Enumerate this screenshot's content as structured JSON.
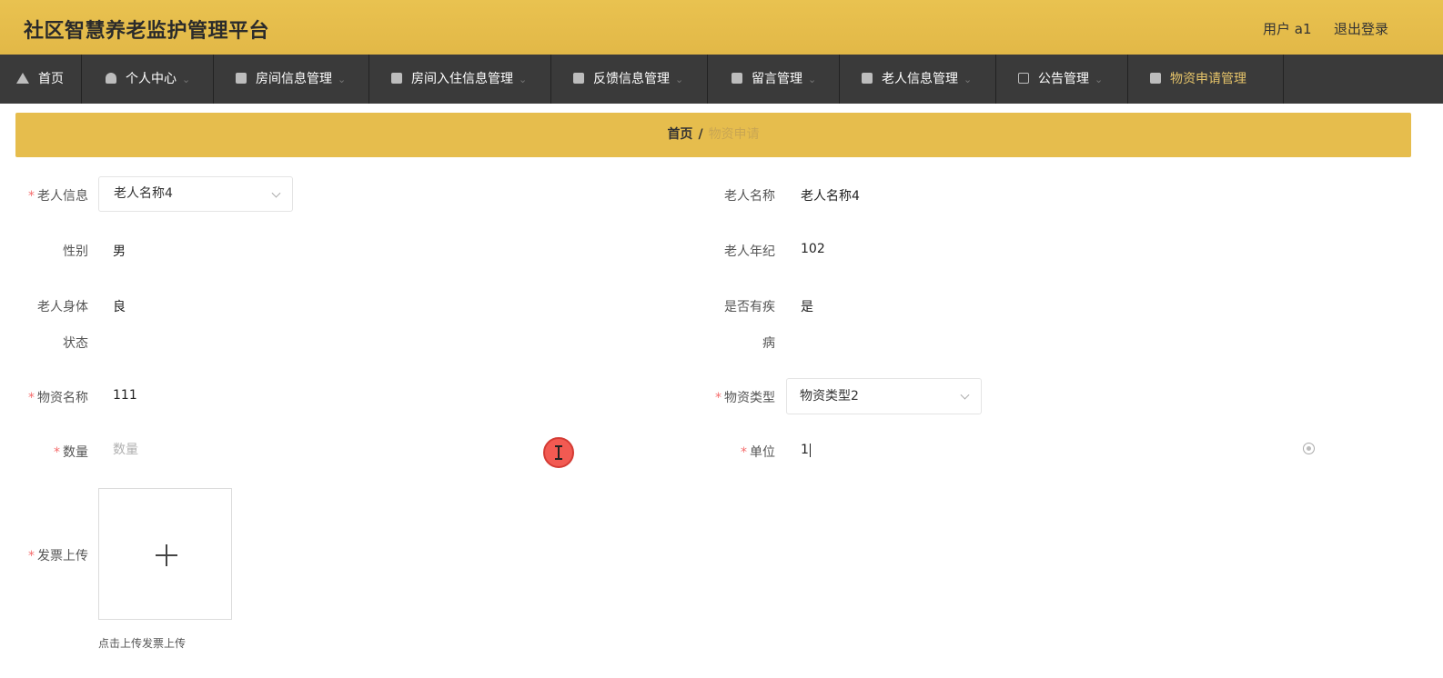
{
  "header": {
    "app_title": "社区智慧养老监护管理平台",
    "user_label": "用户 a1",
    "logout_label": "退出登录"
  },
  "nav": {
    "items": [
      {
        "label": "首页",
        "icon": "home-icon"
      },
      {
        "label": "个人中心",
        "icon": "user-icon"
      },
      {
        "label": "房间信息管理",
        "icon": "briefcase-icon"
      },
      {
        "label": "房间入住信息管理",
        "icon": "monitor-icon"
      },
      {
        "label": "反馈信息管理",
        "icon": "clipboard-icon"
      },
      {
        "label": "留言管理",
        "icon": "document-icon"
      },
      {
        "label": "老人信息管理",
        "icon": "monitor-icon"
      },
      {
        "label": "公告管理",
        "icon": "mail-icon"
      },
      {
        "label": "物资申请管理",
        "icon": "clipboard-icon"
      }
    ],
    "active_index": 8,
    "chevron": "⌄"
  },
  "breadcrumb": {
    "home": "首页",
    "separator": "/",
    "current": "物资申请"
  },
  "form": {
    "elder_info": {
      "label": "老人信息",
      "value": "老人名称4"
    },
    "elder_name": {
      "label": "老人名称",
      "value": "老人名称4"
    },
    "gender": {
      "label": "性别",
      "value": "男"
    },
    "elder_age": {
      "label": "老人年纪",
      "value": "102"
    },
    "body_status": {
      "label_line1": "老人身体",
      "label_line2": "状态",
      "value": "良"
    },
    "has_disease": {
      "label_line1": "是否有疾",
      "label_line2": "病",
      "value": "是"
    },
    "material_name": {
      "label": "物资名称",
      "value": "111"
    },
    "material_type": {
      "label": "物资类型",
      "value": "物资类型2"
    },
    "quantity": {
      "label": "数量",
      "placeholder": "数量",
      "value": ""
    },
    "unit": {
      "label": "单位",
      "value": "1"
    },
    "invoice_upload": {
      "label": "发票上传",
      "hint": "点击上传发票上传"
    },
    "required_mark": "*"
  },
  "colors": {
    "header_gold": "#e6bd4d",
    "nav_dark": "#3a3a3a",
    "active_nav_text": "#e6c46a",
    "required": "#f56c6c"
  }
}
